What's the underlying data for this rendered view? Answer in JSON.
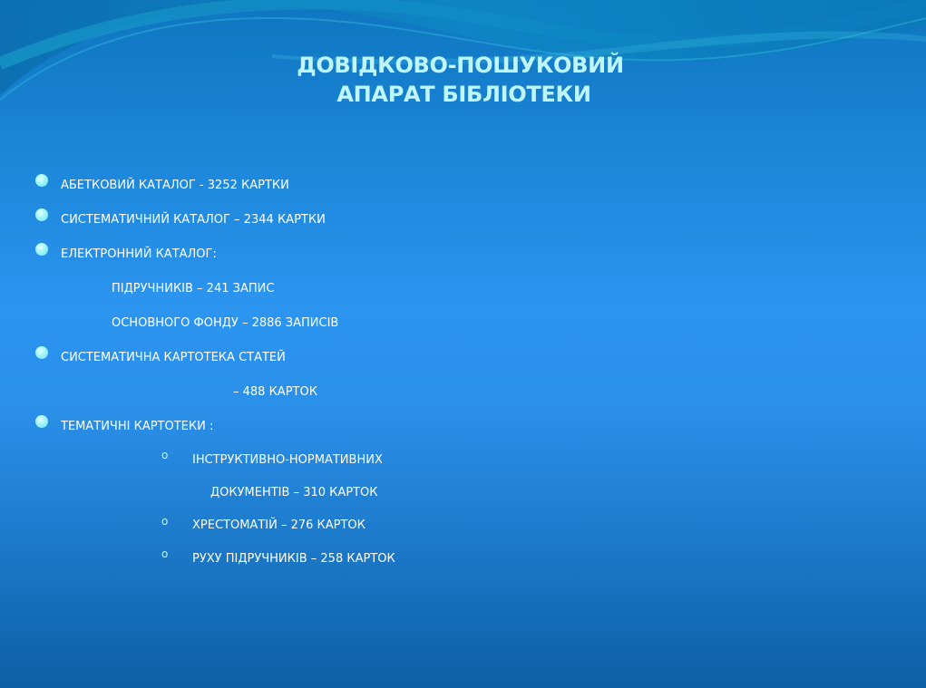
{
  "slide": {
    "title_line1": "ДОВІДКОВО-ПОШУКОВИЙ",
    "title_line2": "АПАРАТ БІБЛІОТЕКИ",
    "items": [
      "АБЕТКОВИЙ КАТАЛОГ  -  3252 КАРТКИ",
      "СИСТЕМАТИЧНИЙ КАТАЛОГ  –  2344 КАРТКИ",
      "ЕЛЕКТРОННИЙ КАТАЛОГ:",
      "ПІДРУЧНИКІВ – 241 ЗАПИС",
      "ОСНОВНОГО ФОНДУ – 2886 ЗАПИСІВ",
      "СИСТЕМАТИЧНА КАРТОТЕКА СТАТЕЙ",
      "– 488 КАРТОК",
      "ТЕМАТИЧНІ КАРТОТЕКИ :"
    ],
    "subitems": [
      "ІНСТРУКТИВНО-НОРМАТИВНИХ",
      "ДОКУМЕНТІВ – 310 КАРТОК",
      "ХРЕСТОМАТІЙ – 276 КАРТОК",
      "РУХУ ПІДРУЧНИКІВ – 258 КАРТОК"
    ],
    "sub_bullet_glyph": "o"
  },
  "colors": {
    "title": "#bff6fb",
    "text": "#ffffff",
    "bullet": "#9ff4fb",
    "background_top": "#0e76bf",
    "background_mid": "#2b95f0",
    "background_bottom": "#0e5fa4"
  }
}
